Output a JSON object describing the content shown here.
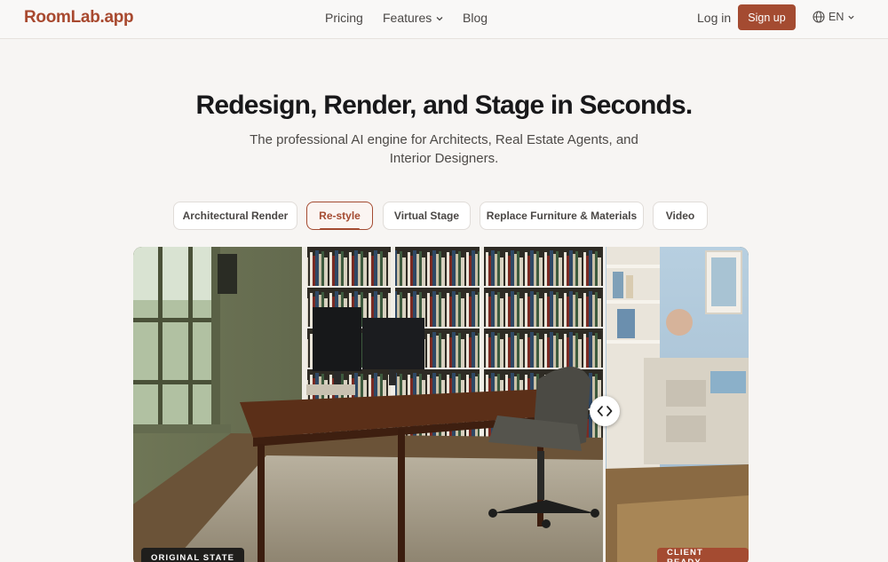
{
  "brand": {
    "name": "RoomLab.app",
    "accent_color": "#a44b31"
  },
  "nav": {
    "links": [
      {
        "label": "Pricing"
      },
      {
        "label": "Features"
      },
      {
        "label": "Blog"
      }
    ],
    "login_label": "Log in",
    "signup_label": "Sign up",
    "language": "EN"
  },
  "hero": {
    "title": "Redesign, Render, and Stage in Seconds.",
    "subtitle": "The professional AI engine for Architects, Real Estate Agents, and Interior Designers."
  },
  "tabs": [
    {
      "label": "Architectural Render",
      "active": false
    },
    {
      "label": "Re-style",
      "active": true
    },
    {
      "label": "Virtual Stage",
      "active": false
    },
    {
      "label": "Replace Furniture & Materials",
      "active": false
    },
    {
      "label": "Video",
      "active": false
    }
  ],
  "compare": {
    "before_label": "ORIGINAL STATE",
    "after_label": "CLIENT READY"
  }
}
